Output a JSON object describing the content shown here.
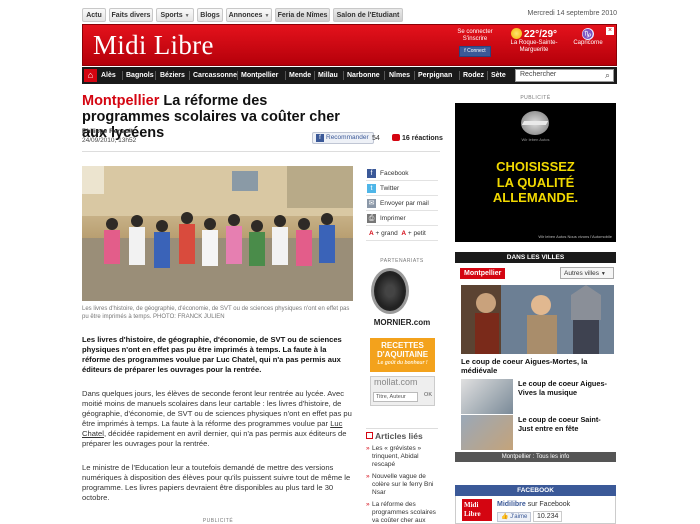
{
  "topnav": {
    "items": [
      "Actu",
      "Faits divers",
      "Sports",
      "Blogs",
      "Annonces",
      "Feria de Nîmes",
      "Salon de l'Etudiant"
    ],
    "date": "Mercredi 14 septembre 2010"
  },
  "header": {
    "logo": "Midi Libre",
    "connect_l1": "Se connecter",
    "connect_l2": "S'inscrire",
    "connect_btn": "Connect",
    "weather_temp": "22°/29°",
    "weather_place_l1": "La Roque-Sainte-",
    "weather_place_l2": "Marguerite",
    "horoscope": "Capricorne"
  },
  "citybar": {
    "cities": [
      "Alès",
      "Bagnols",
      "Béziers",
      "Carcassonne",
      "Montpellier",
      "Mende",
      "Millau",
      "Narbonne",
      "Nîmes",
      "Perpignan",
      "Rodez",
      "Sète"
    ],
    "search_placeholder": "Rechercher"
  },
  "article": {
    "city": "Montpellier",
    "title": "La réforme des programmes scolaires va coûter cher aux lycéens",
    "author": "Philippe Renault",
    "date": "24/09/2010, 13h52",
    "recommend": "Recommander",
    "recommend_count": "54",
    "reactions": "16 réactions",
    "caption": "Les livres d'histoire, de géographie, d'économie, de SVT ou de sciences physiques n'ont en effet pas pu être imprimés à temps. PHOTO: FRANCK JULIEN",
    "lead": "Les livres d'histoire, de géographie, d'économie, de SVT ou de sciences physiques n'ont en effet pas pu être imprimés à temps. La faute à la réforme des programmes voulue par Luc Chatel, qui n'a pas permis aux éditeurs de préparer les ouvrages pour la rentrée.",
    "body1_a": "Dans quelques jours, les élèves de seconde feront leur rentrée au lycée. Avec moitié moins de manuels scolaires dans leur cartable : les livres d'histoire, de géographie, d'économie, de SVT ou de sciences physiques n'ont en effet pas pu être imprimés à temps. La faute à la réforme des programmes voulue par ",
    "body1_link": "Luc Chatel",
    "body1_b": ", décidée rapidement en avril dernier, qui n'a pas permis aux éditeurs de préparer les ouvrages pour la rentrée.",
    "body2": "Le ministre de l'Education leur a toutefois demandé de mettre des versions numériques à disposition des élèves pour qu'ils puissent suivre tout de même le programme. Les livres papiers devraient être disponibles au plus tard le 30 octobre.",
    "publicite": "PUBLICITÉ"
  },
  "share": {
    "items": [
      "Facebook",
      "Twitter",
      "Envoyer par mail",
      "Imprimer"
    ],
    "size_plus": "+ grand",
    "size_minus": "+ petit"
  },
  "partners": {
    "label": "PARTENARIATS",
    "mornier": "MORNIER.com",
    "recettes_l1": "RECETTES",
    "recettes_l2": "D'AQUITAINE",
    "recettes_l3": "Le goût du bonheur !",
    "mollat": "mollat.com",
    "mollat_input": "Titre, Auteur",
    "mollat_ok": "OK"
  },
  "related": {
    "heading": "Articles liés",
    "items": [
      "Les « grévistes » trinquent, Abidal rescapé",
      "Nouvelle vague de colère sur le ferry Bni Nsar",
      "La réforme des programmes scolaires va coûter cher aux"
    ]
  },
  "right": {
    "pub_label": "PUBLICITÉ",
    "ad_l1": "CHOISISSEZ",
    "ad_l2": "LA QUALITÉ ALLEMANDE.",
    "ad_small": "Wir leben Autos",
    "ad_fine": "Wir leben Autos  Nous vivons l'Automobile",
    "dans_les_villes": "DANS LES VILLES",
    "city_tag": "Montpellier",
    "autres_villes": "Autres villes",
    "headline1": "Le coup de coeur Aigues-Mortes, la médiévale",
    "headline2": "Le coup de coeur Aigues-Vives la musique",
    "headline3": "Le coup de coeur Saint-Just entre en fête",
    "tous_les_info": "Montpellier : Tous les info",
    "facebook_heading": "FACEBOOK",
    "fb_logo": "Midi Libre",
    "fb_name": "Midilibre",
    "fb_on": "sur Facebook",
    "fb_like": "J'aime",
    "fb_count": "10.234"
  },
  "colors": {
    "brand_red": "#d40511",
    "facebook_blue": "#3b5998",
    "ad_yellow": "#f1d800"
  }
}
